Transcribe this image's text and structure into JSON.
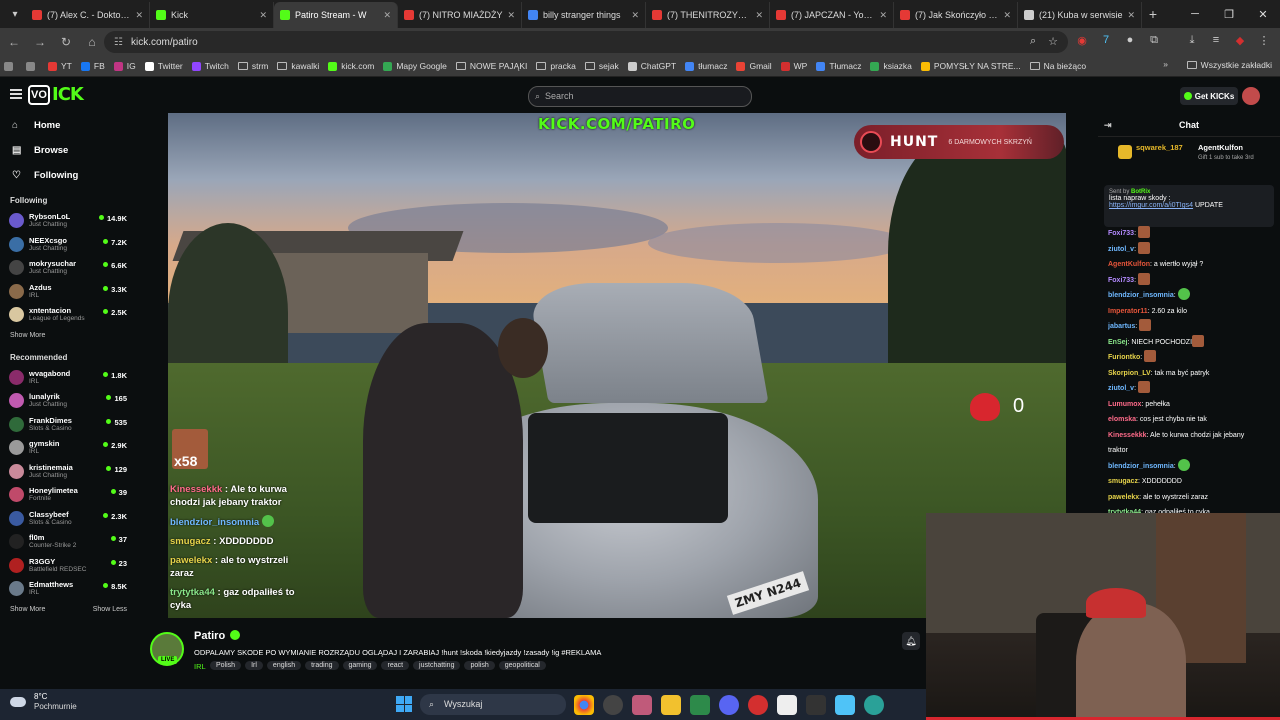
{
  "browser": {
    "tabs": [
      {
        "label": "(7) Alex C. - Doktorsp",
        "color": "#e53935",
        "active": false
      },
      {
        "label": "Kick",
        "color": "#53fc18",
        "active": false
      },
      {
        "label": "Patiro Stream - W",
        "color": "#53fc18",
        "active": true
      },
      {
        "label": "(7) NITRO MIAŻDŻY",
        "color": "#e53935",
        "active": false
      },
      {
        "label": "billy stranger things",
        "color": "#4285f4",
        "active": false
      },
      {
        "label": "(7) THENITROZYNIAI",
        "color": "#e53935",
        "active": false
      },
      {
        "label": "(7) JAPCZAN - YouTu",
        "color": "#e53935",
        "active": false
      },
      {
        "label": "(7) Jak Skończyło XA",
        "color": "#e53935",
        "active": false
      },
      {
        "label": "(21) Kuba w serwisie",
        "color": "#cccccc",
        "active": false
      }
    ],
    "url": "kick.com/patiro",
    "bookmarks": [
      {
        "label": "",
        "color": "#888888"
      },
      {
        "label": "",
        "color": "#888888"
      },
      {
        "label": "YT",
        "color": "#e53935"
      },
      {
        "label": "FB",
        "color": "#1877f2"
      },
      {
        "label": "IG",
        "color": "#c13584"
      },
      {
        "label": "Twitter",
        "color": "#ffffff"
      },
      {
        "label": "Twitch",
        "color": "#9146ff"
      },
      {
        "label": "strm",
        "color": "folder"
      },
      {
        "label": "kawalki",
        "color": "folder"
      },
      {
        "label": "kick.com",
        "color": "#53fc18"
      },
      {
        "label": "Mapy Google",
        "color": "#34a853"
      },
      {
        "label": "NOWE PAJĄKI",
        "color": "folder"
      },
      {
        "label": "pracka",
        "color": "folder"
      },
      {
        "label": "sejak",
        "color": "folder"
      },
      {
        "label": "ChatGPT",
        "color": "#cccccc"
      },
      {
        "label": "tłumacz",
        "color": "#4285f4"
      },
      {
        "label": "Gmail",
        "color": "#ea4335"
      },
      {
        "label": "WP",
        "color": "#d32f2f"
      },
      {
        "label": "Tłumacz",
        "color": "#4285f4"
      },
      {
        "label": "ksiazka",
        "color": "#34a853"
      },
      {
        "label": "POMYSŁY NA STRE...",
        "color": "#fbbc04"
      },
      {
        "label": "Na bieżąco",
        "color": "folder"
      }
    ],
    "bookmarks_all": "Wszystkie zakładki"
  },
  "header": {
    "search_placeholder": "Search",
    "get_kicks": "Get KICKs"
  },
  "sidebar": {
    "nav": [
      {
        "label": "Home",
        "icon": "home-icon"
      },
      {
        "label": "Browse",
        "icon": "browse-icon"
      },
      {
        "label": "Following",
        "icon": "heart-icon"
      }
    ],
    "following_title": "Following",
    "following": [
      {
        "name": "RybsonLoL",
        "category": "Just Chatting",
        "viewers": "14.9K",
        "color": "#6a5acd"
      },
      {
        "name": "NEEXcsgo",
        "category": "Just Chatting",
        "viewers": "7.2K",
        "color": "#3a6ea5"
      },
      {
        "name": "mokrysuchar",
        "category": "Just Chatting",
        "viewers": "6.6K",
        "color": "#444444"
      },
      {
        "name": "Azdus",
        "category": "IRL",
        "viewers": "3.3K",
        "color": "#8a6a4a"
      },
      {
        "name": "xntentacion",
        "category": "League of Legends",
        "viewers": "2.5K",
        "color": "#d9c7a0"
      }
    ],
    "show_more": "Show More",
    "recommended_title": "Recommended",
    "recommended": [
      {
        "name": "wvagabond",
        "category": "IRL",
        "viewers": "1.8K",
        "color": "#8a2b6a"
      },
      {
        "name": "lunalyrik",
        "category": "Just Chatting",
        "viewers": "165",
        "color": "#c05ab0"
      },
      {
        "name": "FrankDimes",
        "category": "Slots & Casino",
        "viewers": "535",
        "color": "#2f6a3a"
      },
      {
        "name": "gymskin",
        "category": "IRL",
        "viewers": "2.9K",
        "color": "#9a9a9a"
      },
      {
        "name": "kristinemaia",
        "category": "Just Chatting",
        "viewers": "129",
        "color": "#c98a9a"
      },
      {
        "name": "Honeylimetea",
        "category": "Fortnite",
        "viewers": "39",
        "color": "#c04a6a"
      },
      {
        "name": "Classybeef",
        "category": "Slots & Casino",
        "viewers": "2.3K",
        "color": "#3a5aa0"
      },
      {
        "name": "fl0m",
        "category": "Counter-Strike 2",
        "viewers": "37",
        "color": "#222222"
      },
      {
        "name": "R3GGY",
        "category": "Battlefield REDSEC",
        "viewers": "23",
        "color": "#b02020"
      },
      {
        "name": "Edmatthews",
        "category": "IRL",
        "viewers": "8.5K",
        "color": "#6a7a8a"
      }
    ],
    "show_less": "Show Less"
  },
  "video": {
    "overlay_url": "KICK.COM/PATIRO",
    "hunt_label": "HUNT",
    "hunt_sub": "6 DARMOWYCH SKRZYŃ",
    "heart_count": "0",
    "boost_count": "x58",
    "overlay_chat": [
      {
        "user": "Kinessekkk",
        "text": "Ale to kurwa chodzi jak jebany traktor",
        "color": "#ff6b8a"
      },
      {
        "user": "blendzior_insomnia",
        "text": "",
        "color": "#6fb8ff"
      },
      {
        "user": "smugacz",
        "text": "XDDDDDDD",
        "color": "#e6d34a"
      },
      {
        "user": "pawelekx",
        "text": "ale to wystrzeli zaraz",
        "color": "#e6d34a"
      },
      {
        "user": "trytytka44",
        "text": "gaz odpaliłeś to cyka",
        "color": "#8ae68a"
      }
    ]
  },
  "stream": {
    "name": "Patiro",
    "live": "LIVE",
    "title": "ODPALAMY SKODE PO WYMIANIE ROZRZĄDU OGLĄDAJ I ZARABIAJ !hunt !skoda !kiedyjazdy !zasady !ig #REKLAMA",
    "category": "IRL",
    "tags": [
      "Polish",
      "Irl",
      "english",
      "trading",
      "gaming",
      "react",
      "justchatting",
      "polish",
      "geopolitical"
    ]
  },
  "chat": {
    "title": "Chat",
    "gifter": "sqwarek_187",
    "gift_user": "AgentKulfon",
    "gift_sub": "Gift 1 sub to take 3rd",
    "pinned_sender": "Sent by",
    "pinned_bot": "BotRix",
    "pinned_text": "lista napraw skody :",
    "pinned_link": "https://imgur.com/a/i0TIgs4",
    "pinned_update": "UPDATE",
    "messages": [
      {
        "user": "Foxi733",
        "text": "",
        "color": "#b48aff",
        "emote": "face"
      },
      {
        "user": "ziutol_v",
        "text": "",
        "color": "#6fb8ff",
        "emote": "face"
      },
      {
        "user": "AgentKulfon",
        "text": "a wiertło wyjął ?",
        "color": "#e6553a",
        "emote": ""
      },
      {
        "user": "Foxi733",
        "text": "",
        "color": "#b48aff",
        "emote": "face"
      },
      {
        "user": "blendzior_insomnia",
        "text": "",
        "color": "#6fb8ff",
        "emote": "green"
      },
      {
        "user": "Imperator11",
        "text": "2.60 za kilo",
        "color": "#e6553a",
        "emote": ""
      },
      {
        "user": "jabartus",
        "text": "",
        "color": "#6fb8ff",
        "emote": "face"
      },
      {
        "user": "EnSej",
        "text": "NIECH POCHODZI",
        "color": "#8ae68a",
        "emote": "face"
      },
      {
        "user": "Furiontko",
        "text": "",
        "color": "#e6d34a",
        "emote": "face"
      },
      {
        "user": "Skorpion_LV",
        "text": "tak ma być patryk",
        "color": "#e6d34a",
        "emote": ""
      },
      {
        "user": "ziutol_v",
        "text": "",
        "color": "#6fb8ff",
        "emote": "face"
      },
      {
        "user": "Lumumox",
        "text": "pehełka",
        "color": "#ff6b8a",
        "emote": ""
      },
      {
        "user": "elomska",
        "text": "cos jest chyba nie tak",
        "color": "#ff6b8a",
        "emote": ""
      },
      {
        "user": "Kinessekkk",
        "text": "Ale to kurwa chodzi jak jebany",
        "color": "#ff6b8a",
        "emote": ""
      },
      {
        "user": "",
        "text": "traktor",
        "color": "#ffffff",
        "emote": ""
      },
      {
        "user": "blendzior_insomnia",
        "text": "",
        "color": "#6fb8ff",
        "emote": "green"
      },
      {
        "user": "smugacz",
        "text": "XDDDDDDD",
        "color": "#e6d34a",
        "emote": ""
      },
      {
        "user": "pawelekx",
        "text": "ale to wystrzeli zaraz",
        "color": "#e6d34a",
        "emote": ""
      },
      {
        "user": "trytytka44",
        "text": "gaz odpaliłeś to cyka",
        "color": "#8ae68a",
        "emote": ""
      }
    ]
  },
  "taskbar": {
    "temp": "8°C",
    "weather": "Pochmurnie",
    "search": "Wyszukaj"
  }
}
